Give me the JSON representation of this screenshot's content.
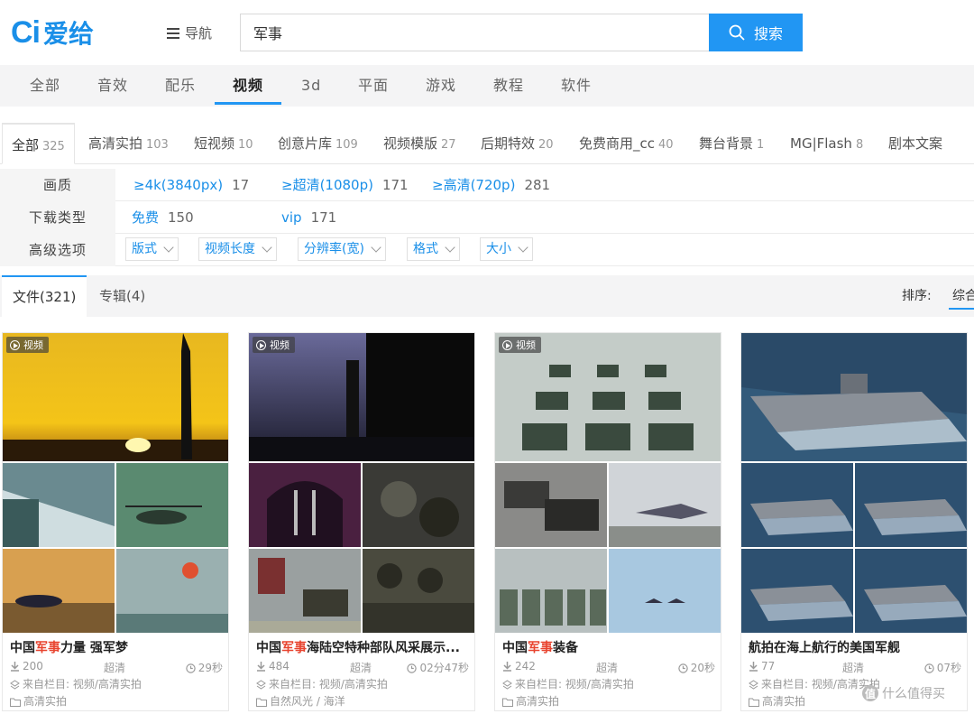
{
  "logo": {
    "ci": "Ci",
    "text": "爱给"
  },
  "nav_label": "导航",
  "search": {
    "value": "军事",
    "button": "搜索"
  },
  "categories": [
    "全部",
    "音效",
    "配乐",
    "视频",
    "3d",
    "平面",
    "游戏",
    "教程",
    "软件"
  ],
  "active_category": "视频",
  "sub_tabs": [
    {
      "label": "全部",
      "count": "325"
    },
    {
      "label": "高清实拍",
      "count": "103"
    },
    {
      "label": "短视频",
      "count": "10"
    },
    {
      "label": "创意片库",
      "count": "109"
    },
    {
      "label": "视频模版",
      "count": "27"
    },
    {
      "label": "后期特效",
      "count": "20"
    },
    {
      "label": "免费商用_cc",
      "count": "40"
    },
    {
      "label": "舞台背景",
      "count": "1"
    },
    {
      "label": "MG|Flash",
      "count": "8"
    },
    {
      "label": "剧本文案",
      "count": ""
    }
  ],
  "filters": {
    "quality": {
      "label": "画质",
      "options": [
        {
          "label": "≥4k(3840px)",
          "count": "17"
        },
        {
          "label": "≥超清(1080p)",
          "count": "171"
        },
        {
          "label": "≥高清(720p)",
          "count": "281"
        }
      ]
    },
    "download": {
      "label": "下载类型",
      "options": [
        {
          "label": "免费",
          "count": "150"
        },
        {
          "label": "vip",
          "count": "171"
        }
      ]
    },
    "advanced": {
      "label": "高级选项",
      "dropdowns": [
        "版式",
        "视频长度",
        "分辨率(宽)",
        "格式",
        "大小"
      ]
    }
  },
  "file_tabs": {
    "files": "文件(321)",
    "albums": "专辑(4)"
  },
  "sort": {
    "label": "排序:",
    "value": "综合"
  },
  "cards": [
    {
      "badge": "视频",
      "title_pre": "中国",
      "title_hl": "军事",
      "title_post": "力量 强军梦",
      "downloads": "200",
      "quality": "超清",
      "duration": "29秒",
      "source": "来自栏目: 视频/高清实拍",
      "tag": "高清实拍"
    },
    {
      "badge": "视频",
      "title_pre": "中国",
      "title_hl": "军事",
      "title_post": "海陆空特种部队风采展示...",
      "downloads": "484",
      "quality": "超清",
      "duration": "02分47秒",
      "source": "来自栏目: 视频/高清实拍",
      "tag": "自然风光 / 海洋"
    },
    {
      "badge": "视频",
      "title_pre": "中国",
      "title_hl": "军事",
      "title_post": "装备",
      "downloads": "242",
      "quality": "超清",
      "duration": "20秒",
      "source": "来自栏目: 视频/高清实拍",
      "tag": "高清实拍"
    },
    {
      "badge": "",
      "title_pre": "航拍在海上航行的美国军舰",
      "title_hl": "",
      "title_post": "",
      "downloads": "77",
      "quality": "超清",
      "duration": "07秒",
      "source": "来自栏目: 视频/高清实拍",
      "tag": "高清实拍"
    }
  ],
  "watermark": {
    "symbol": "值",
    "text": "什么值得买"
  },
  "colors": {
    "accent": "#2196f3",
    "highlight": "#e8432e",
    "logo": "#1a8fe8"
  }
}
